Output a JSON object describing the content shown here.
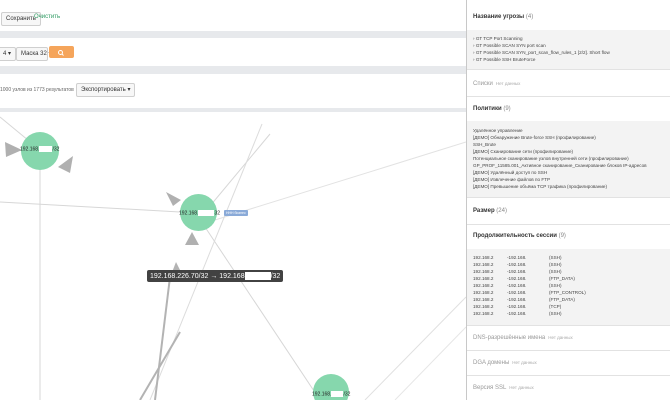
{
  "toolbar": {
    "save_label": "Сохранить",
    "clear_label": "Очистить",
    "number_value": "4",
    "mask_label": "Маска 32",
    "search_icon": "search-icon",
    "accent": "#f5a55b"
  },
  "results": {
    "summary": "1000 узлов из 1773 результатов",
    "export_label": "Экспортировать"
  },
  "graph": {
    "node1_prefix": "192.168.",
    "node1_suffix": "/32",
    "node2_prefix": "192.168.",
    "node2_suffix": "32",
    "node2_tag": "ННН бизнес",
    "node3_prefix": "192.168.",
    "node3_suffix": "/32",
    "tooltip_left": "192.168.226.70/32 → 192.168",
    "tooltip_right": "/32",
    "node_color": "#86d7ad"
  },
  "panel": {
    "threat": {
      "title": "Название угрозы",
      "count": "(4)",
      "items": [
        "GT TCP Port Scanning",
        "GT Possible SCAN SYN port scan",
        "GT Possible SCAN SYN_port_scan_flow_rules_1 [2/2]. Short flow",
        "GT Possible SSH BruteForce"
      ]
    },
    "lists": {
      "title": "Списки",
      "nodata": "Нет данных"
    },
    "policies": {
      "title": "Политики",
      "count": "(9)",
      "items": [
        "Удалённое управление",
        "[ДЕМО] Обнаружение Brute-force SSH (профилирование)",
        "SSH_Brute",
        "[ДЕМО] Сканирование сети (профилирование)",
        "Потенциальное сканирование узлов внутренней сети (профилирование)",
        "GP_PROF_11585.001_Активное сканирование_Сканирование блоков IP-адресов",
        "[ДЕМО] Удалённый доступ по SSH",
        "[ДЕМО] Извлечение файлов по FTP",
        "[ДЕМО] Превышение объёма TCP трафика (профилирование)"
      ]
    },
    "size": {
      "title": "Размер",
      "count": "(24)"
    },
    "duration": {
      "title": "Продолжительность сессии",
      "count": "(9)",
      "rows": [
        [
          "192.168.2",
          "-192.168.",
          "(SSH)"
        ],
        [
          "192.168.2",
          "-192.168.",
          "(SSH)"
        ],
        [
          "192.168.2",
          "-192.168.",
          "(SSH)"
        ],
        [
          "192.168.2",
          "-192.168.",
          "(FTP_DATA)"
        ],
        [
          "192.168.2",
          "-192.168.",
          "(SSH)"
        ],
        [
          "192.168.2",
          "-192.168.",
          "(FTP_CONTROL)"
        ],
        [
          "192.168.2",
          "-192.168.",
          "(FTP_DATA)"
        ],
        [
          "192.168.2",
          "-192.168.",
          "(TCP)"
        ],
        [
          "192.168.2",
          "-192.168.",
          "(SSH)"
        ]
      ]
    },
    "dns": {
      "title": "DNS-разрешённые имена",
      "nodata": "Нет данных"
    },
    "dga": {
      "title": "DGA домены",
      "nodata": "Нет данных"
    },
    "ssl": {
      "title": "Версия SSL",
      "nodata": "Нет данных"
    }
  }
}
